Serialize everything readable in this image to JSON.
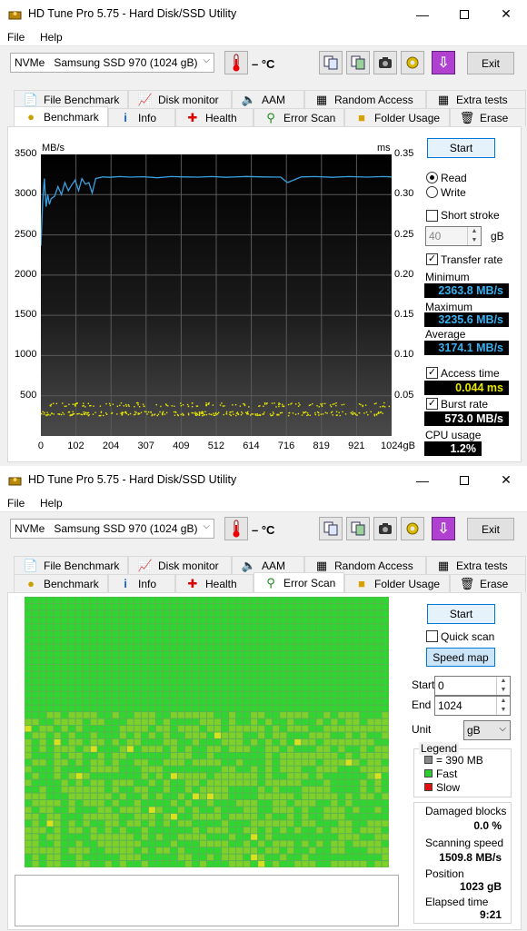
{
  "app": {
    "title": "HD Tune Pro 5.75 - Hard Disk/SSD Utility",
    "menu": [
      "File",
      "Help"
    ],
    "drive_prefix": "NVMe",
    "drive_name": "Samsung SSD 970 (1024 gB)",
    "temperature": "– °C",
    "exit_label": "Exit",
    "tabs_top": [
      "File Benchmark",
      "Disk monitor",
      "AAM",
      "Random Access",
      "Extra tests"
    ],
    "tabs_bottom": [
      "Benchmark",
      "Info",
      "Health",
      "Error Scan",
      "Folder Usage",
      "Erase"
    ]
  },
  "benchmark": {
    "start_label": "Start",
    "read_label": "Read",
    "write_label": "Write",
    "mode": "read",
    "short_stroke_label": "Short stroke",
    "short_stroke_checked": false,
    "short_stroke_value": "40",
    "short_stroke_unit": "gB",
    "transfer_rate_label": "Transfer rate",
    "transfer_rate_checked": true,
    "minimum_label": "Minimum",
    "minimum_value": "2363.8 MB/s",
    "maximum_label": "Maximum",
    "maximum_value": "3235.6 MB/s",
    "average_label": "Average",
    "average_value": "3174.1 MB/s",
    "access_time_label": "Access time",
    "access_time_checked": true,
    "access_time_value": "0.044 ms",
    "burst_rate_label": "Burst rate",
    "burst_rate_checked": true,
    "burst_rate_value": "573.0 MB/s",
    "cpu_label": "CPU usage",
    "cpu_value": "1.2%"
  },
  "chart_data": {
    "type": "line",
    "left_unit": "MB/s",
    "right_unit": "ms",
    "y_ticks": [
      "3500",
      "3000",
      "2500",
      "2000",
      "1500",
      "1000",
      "500"
    ],
    "y2_ticks": [
      "0.35",
      "0.30",
      "0.25",
      "0.20",
      "0.15",
      "0.10",
      "0.05"
    ],
    "x_ticks": [
      "0",
      "102",
      "204",
      "307",
      "409",
      "512",
      "614",
      "716",
      "819",
      "921",
      "1024gB"
    ],
    "ylim": [
      0,
      3500
    ],
    "y2lim": [
      0,
      0.35
    ],
    "xlim": [
      0,
      1024
    ],
    "grid": true,
    "series": [
      {
        "name": "Transfer rate",
        "color": "#3aa0e0",
        "x": [
          0,
          5,
          10,
          15,
          20,
          25,
          30,
          40,
          50,
          60,
          70,
          80,
          90,
          100,
          110,
          120,
          130,
          140,
          150,
          160,
          180,
          200,
          230,
          260,
          300,
          340,
          380,
          420,
          460,
          500,
          540,
          600,
          650,
          700,
          720,
          760,
          800,
          850,
          900,
          950,
          1000,
          1024
        ],
        "y": [
          2363,
          2900,
          3200,
          2850,
          3000,
          2880,
          2950,
          2980,
          3100,
          3000,
          3150,
          3050,
          3120,
          3180,
          3050,
          3200,
          3130,
          3150,
          3020,
          3200,
          3220,
          3215,
          3225,
          3218,
          3222,
          3210,
          3225,
          3220,
          3218,
          3224,
          3215,
          3226,
          3220,
          3218,
          3150,
          3220,
          3225,
          3215,
          3224,
          3218,
          3225,
          3220
        ]
      }
    ],
    "access_points_band_ms": [
      [
        0.026,
        0.031
      ],
      [
        0.037,
        0.042
      ]
    ],
    "access_points_color": "#e8e800"
  },
  "errorscan": {
    "start_label": "Start",
    "quick_scan_label": "Quick scan",
    "quick_scan_checked": false,
    "speed_map_label": "Speed map",
    "start_field_label": "Start",
    "start_value": "0",
    "end_field_label": "End",
    "end_value": "1024",
    "unit_label": "Unit",
    "unit_value": "gB",
    "legend_title": "Legend",
    "legend_block": "= 390 MB",
    "legend_fast": "Fast",
    "legend_slow": "Slow",
    "legend_block_color": "#888888",
    "legend_fast_color": "#2ecc2e",
    "legend_slow_color": "#e01010",
    "damaged_label": "Damaged blocks",
    "damaged_value": "0.0 %",
    "scan_speed_label": "Scanning speed",
    "scan_speed_value": "1509.8 MB/s",
    "position_label": "Position",
    "position_value": "1023 gB",
    "elapsed_label": "Elapsed time",
    "elapsed_value": "9:21",
    "block_colors": {
      "fast": "#31d531",
      "mid": "#7fd02a",
      "slow": "#d8e020"
    }
  }
}
